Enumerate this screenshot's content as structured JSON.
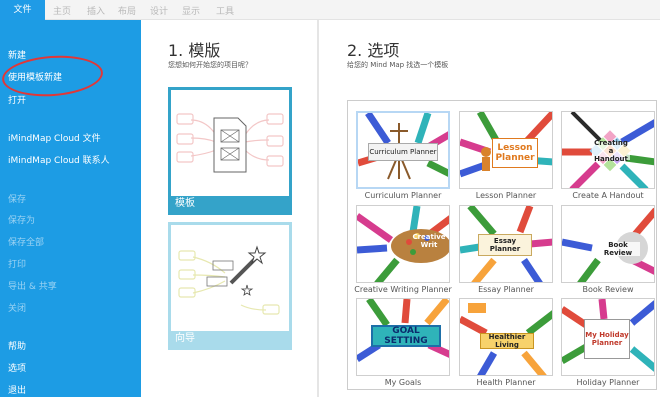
{
  "ribbon": {
    "tabs": [
      "文件",
      "主页",
      "插入",
      "布局",
      "设计",
      "显示",
      "工具"
    ]
  },
  "sidebar": {
    "items": [
      {
        "label": "新建",
        "dim": false
      },
      {
        "label": "使用模板新建",
        "dim": false
      },
      {
        "label": "打开",
        "dim": false
      },
      {
        "label": "iMindMap Cloud 文件",
        "dim": false
      },
      {
        "label": "iMindMap Cloud 联系人",
        "dim": false
      },
      {
        "label": "保存",
        "dim": true
      },
      {
        "label": "保存为",
        "dim": true
      },
      {
        "label": "保存全部",
        "dim": true
      },
      {
        "label": "打印",
        "dim": true
      },
      {
        "label": "导出 & 共享",
        "dim": true
      },
      {
        "label": "关闭",
        "dim": true
      },
      {
        "label": "帮助",
        "dim": false
      },
      {
        "label": "选项",
        "dim": false
      },
      {
        "label": "退出",
        "dim": false
      }
    ]
  },
  "section1": {
    "title": "1. 模版",
    "subtitle": "您想如何开始您的项目呢？",
    "cards": [
      "模板",
      "向导"
    ]
  },
  "section2": {
    "title": "2. 选项",
    "subtitle": "给您的 Mind Map 找选一个模板",
    "options": [
      {
        "caption": "Curriculum Planner",
        "thumb": "Curriculum Planner"
      },
      {
        "caption": "Lesson Planner",
        "thumb": "Lesson Planner"
      },
      {
        "caption": "Create A Handout",
        "thumb": "Creating a Handout"
      },
      {
        "caption": "Creative Writing Planner",
        "thumb": "Creative Writ"
      },
      {
        "caption": "Essay Planner",
        "thumb": "Essay Planner"
      },
      {
        "caption": "Book Review",
        "thumb": "Book Review"
      },
      {
        "caption": "My Goals",
        "thumb": "GOAL SETTING"
      },
      {
        "caption": "Health Planner",
        "thumb": "Healthier Living"
      },
      {
        "caption": "Holiday Planner",
        "thumb": "My Holiday Planner"
      }
    ]
  },
  "colors": {
    "sidebar": "#1d9ce4",
    "accent": "#34a3c9",
    "annotation": "#e23737"
  }
}
